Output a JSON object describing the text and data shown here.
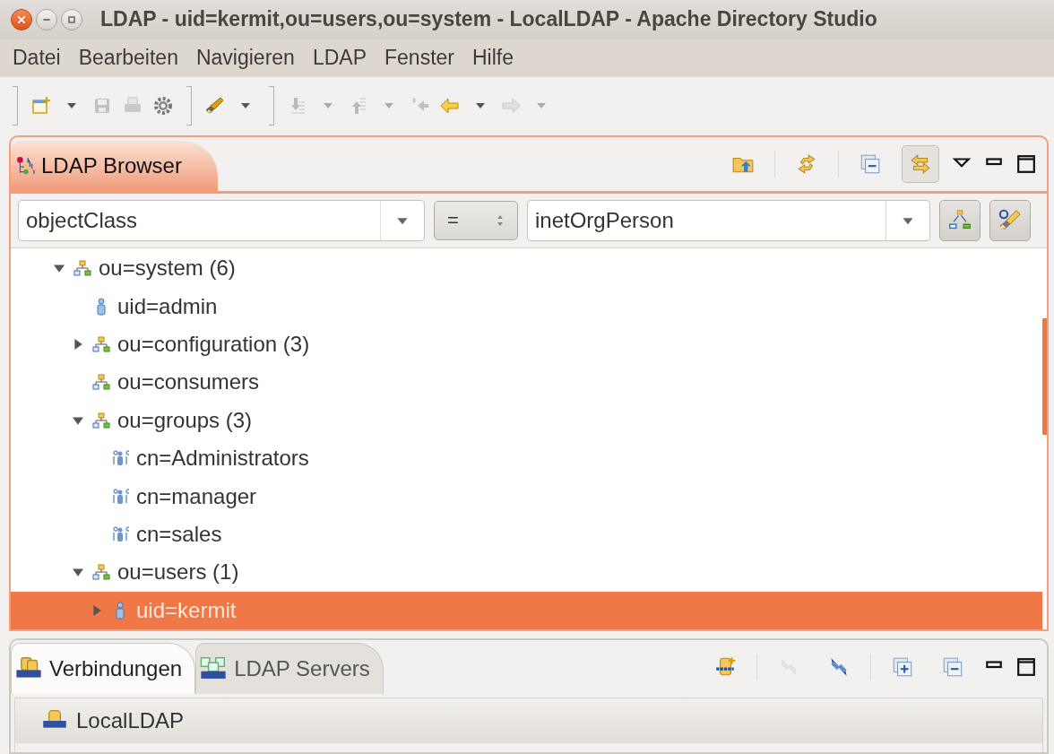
{
  "window": {
    "title": "LDAP - uid=kermit,ou=users,ou=system - LocalLDAP - Apache Directory Studio"
  },
  "menu": [
    "Datei",
    "Bearbeiten",
    "Navigieren",
    "LDAP",
    "Fenster",
    "Hilfe"
  ],
  "toolbar_groups": [
    [
      {
        "kind": "new",
        "disabled": false
      },
      {
        "kind": "dropdown",
        "disabled": false
      },
      {
        "kind": "save",
        "disabled": true
      },
      {
        "kind": "print",
        "disabled": true
      },
      {
        "kind": "gear",
        "disabled": false
      }
    ],
    [
      {
        "kind": "pen",
        "disabled": false
      },
      {
        "kind": "dropdown",
        "disabled": false
      }
    ],
    [
      {
        "kind": "import",
        "disabled": true
      },
      {
        "kind": "dropdown",
        "disabled": true
      },
      {
        "kind": "export",
        "disabled": true
      },
      {
        "kind": "dropdown",
        "disabled": true
      },
      {
        "kind": "history",
        "disabled": true
      },
      {
        "kind": "back",
        "disabled": false
      },
      {
        "kind": "dropdown",
        "disabled": false
      },
      {
        "kind": "forward",
        "disabled": true
      },
      {
        "kind": "dropdown",
        "disabled": true
      }
    ]
  ],
  "browser": {
    "tab": {
      "label": "LDAP Browser",
      "selected": true
    },
    "tool_groups": [
      [
        {
          "kind": "up-folder",
          "on": false
        }
      ],
      [
        {
          "kind": "refresh",
          "on": false
        }
      ],
      [
        {
          "kind": "collapse",
          "on": false
        },
        {
          "kind": "link",
          "on": true
        }
      ]
    ],
    "filter": {
      "attribute": "objectClass",
      "operator": "=",
      "value": "inetOrgPerson"
    },
    "tree": [
      {
        "label": "ou=system (6)",
        "kind": "ou",
        "expanded": true,
        "selected": false,
        "children": [
          {
            "label": "uid=admin",
            "kind": "person",
            "selected": false
          },
          {
            "label": "ou=configuration (3)",
            "kind": "ou",
            "expanded": false,
            "selected": false
          },
          {
            "label": "ou=consumers",
            "kind": "ou",
            "selected": false
          },
          {
            "label": "ou=groups (3)",
            "kind": "ou",
            "expanded": true,
            "selected": false,
            "children": [
              {
                "label": "cn=Administrators",
                "kind": "group",
                "selected": false
              },
              {
                "label": "cn=manager",
                "kind": "group",
                "selected": false
              },
              {
                "label": "cn=sales",
                "kind": "group",
                "selected": false
              }
            ]
          },
          {
            "label": "ou=users (1)",
            "kind": "ou",
            "expanded": true,
            "selected": false,
            "children": [
              {
                "label": "uid=kermit",
                "kind": "person",
                "expanded": false,
                "selected": true
              }
            ]
          }
        ]
      }
    ]
  },
  "connections": {
    "tabs": [
      {
        "label": "Verbindungen",
        "kind": "connections",
        "selected": true
      },
      {
        "label": "LDAP Servers",
        "kind": "servers",
        "selected": false
      }
    ],
    "tool_groups": [
      [
        {
          "kind": "new-connection",
          "disabled": false
        }
      ],
      [
        {
          "kind": "disconnect",
          "disabled": true
        },
        {
          "kind": "connect",
          "disabled": false
        }
      ],
      [
        {
          "kind": "expand",
          "disabled": false
        },
        {
          "kind": "collapse",
          "disabled": false
        }
      ]
    ],
    "items": [
      {
        "label": "LocalLDAP",
        "selected": true
      }
    ]
  }
}
